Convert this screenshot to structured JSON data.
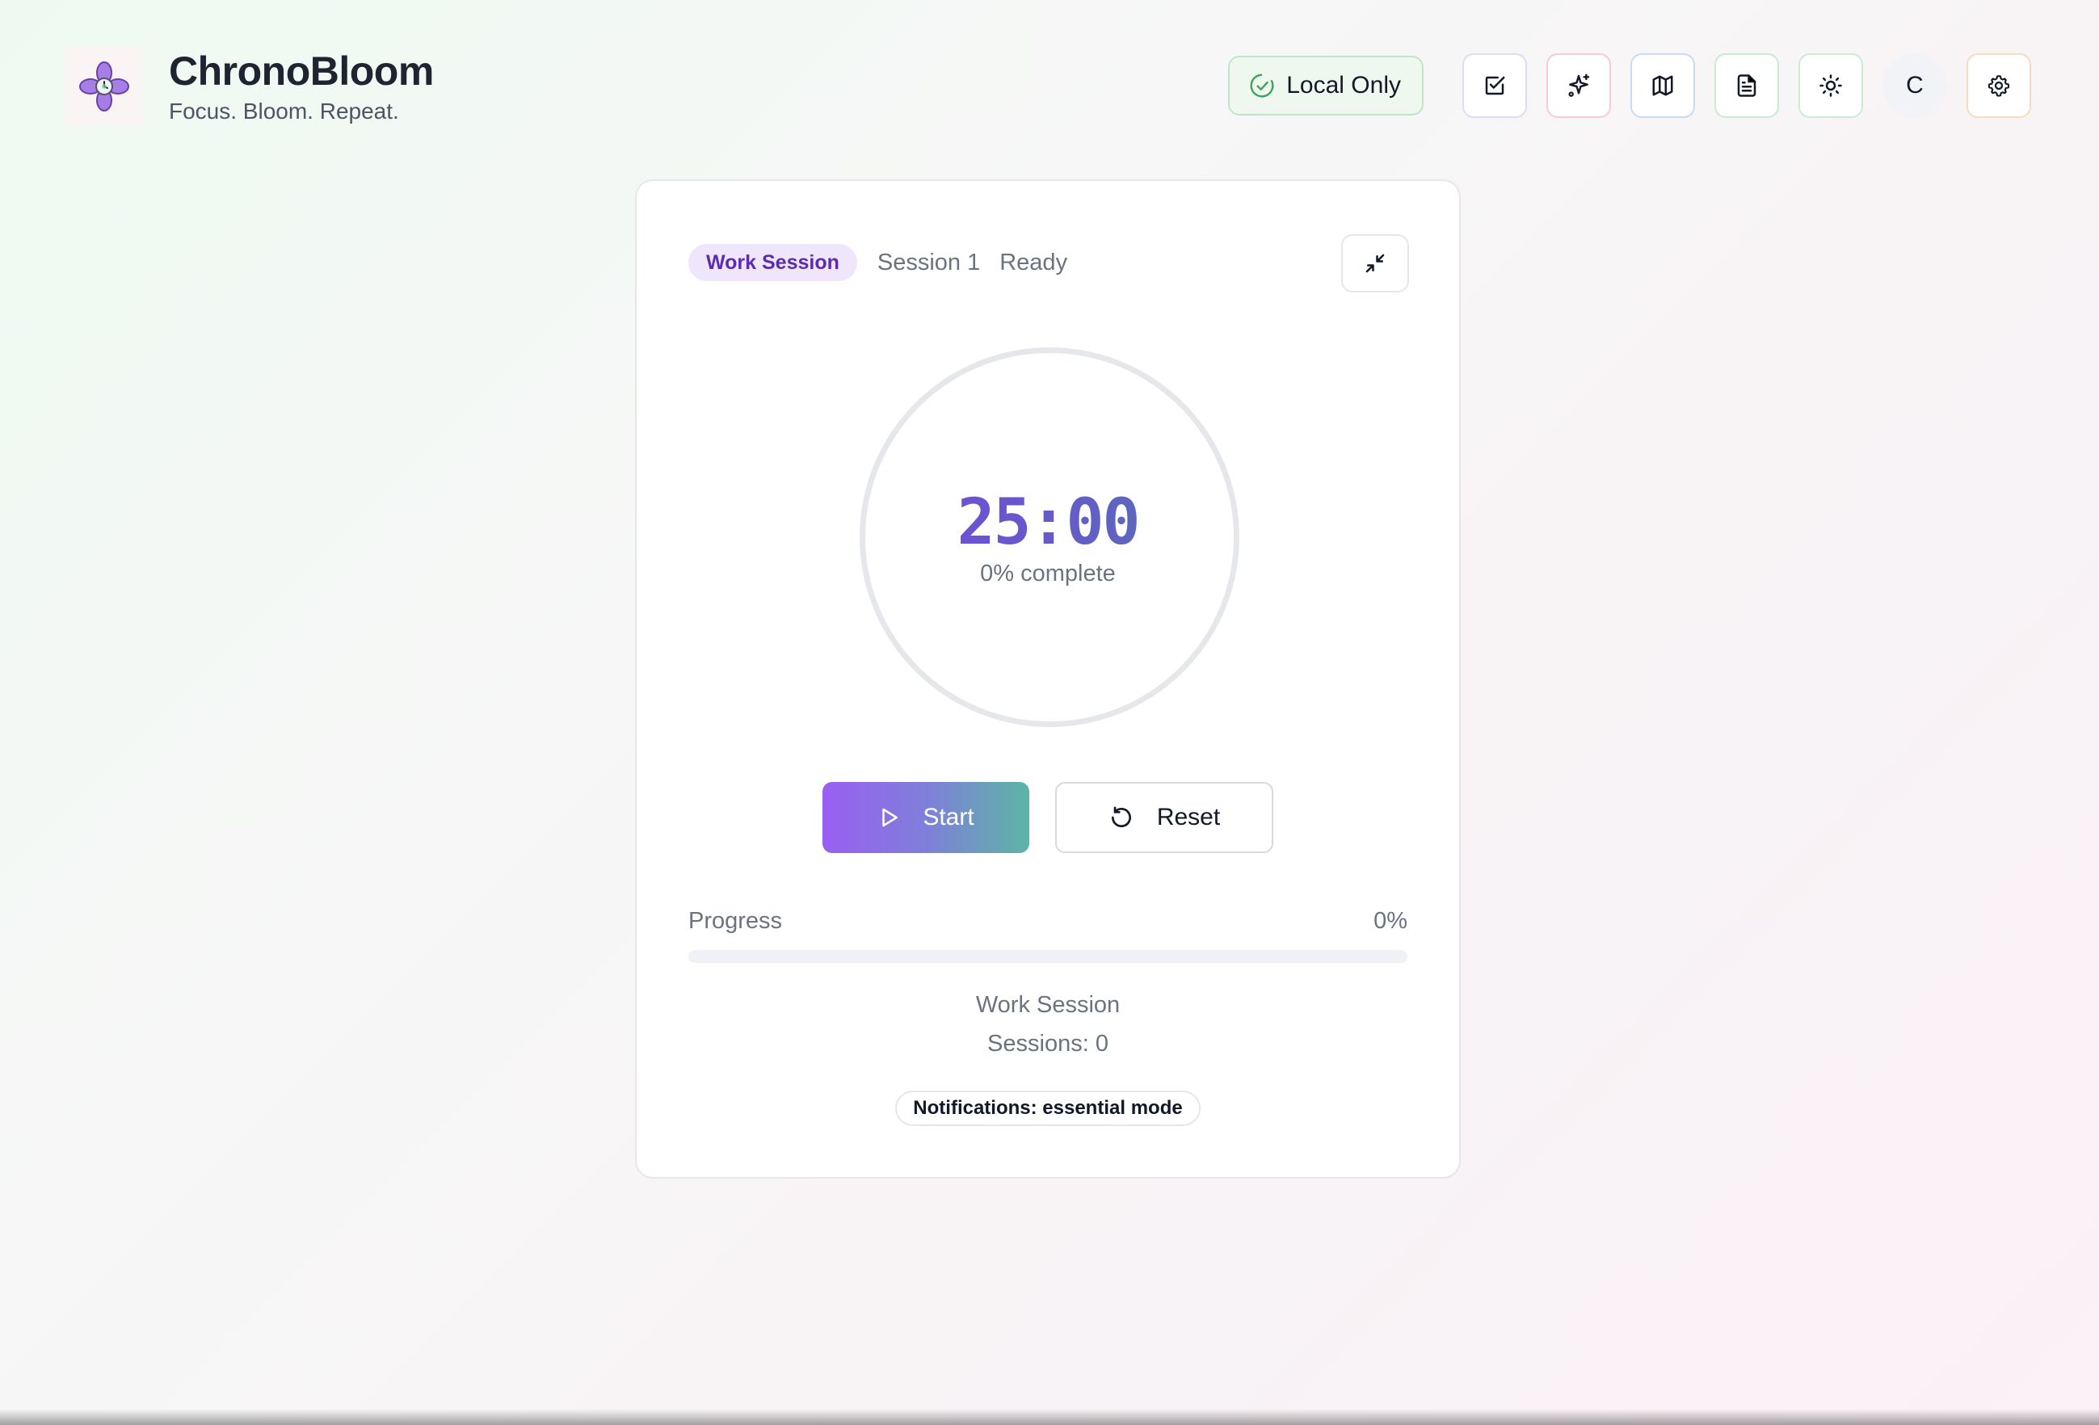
{
  "app": {
    "title": "ChronoBloom",
    "tagline": "Focus. Bloom. Repeat."
  },
  "toolbar": {
    "local_badge": "Local Only",
    "buttons": [
      {
        "name": "tasks",
        "icon": "checkbox-icon"
      },
      {
        "name": "effects",
        "icon": "sparkles-icon"
      },
      {
        "name": "map",
        "icon": "map-icon"
      },
      {
        "name": "notes",
        "icon": "document-icon"
      },
      {
        "name": "theme",
        "icon": "sun-icon"
      },
      {
        "name": "user",
        "label": "C"
      },
      {
        "name": "settings",
        "icon": "gear-icon"
      }
    ]
  },
  "timer": {
    "mode_pill": "Work Session",
    "session_label": "Session 1",
    "status": "Ready",
    "minutes": "25",
    "separator": ":",
    "seconds": "00",
    "complete_text": "0% complete",
    "progress_fraction": 0
  },
  "controls": {
    "start_label": "Start",
    "reset_label": "Reset"
  },
  "progress": {
    "label": "Progress",
    "percent_text": "0%"
  },
  "footer": {
    "mode_text": "Work Session",
    "sessions_text": "Sessions: 0",
    "notifications": "Notifications: essential mode"
  },
  "colors": {
    "accent_purple": "#9a5ef2",
    "accent_teal": "#5cb5a6",
    "pill_text": "#5b2bb0",
    "local_green": "#3aa55a"
  }
}
